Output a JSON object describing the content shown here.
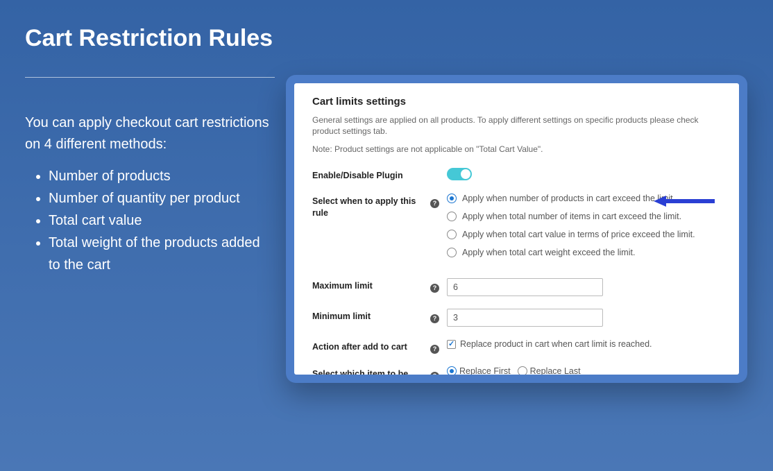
{
  "left": {
    "title": "Cart Restriction Rules",
    "intro": "You can apply checkout cart restrictions on 4 different methods:",
    "bullets": [
      "Number of products",
      "Number of quantity per product",
      "Total cart value",
      "Total weight of the products added to the cart"
    ]
  },
  "panel": {
    "title": "Cart limits settings",
    "sub1": "General settings are applied on all products. To apply different settings on specific products please check product settings tab.",
    "sub2": "Note: Product settings are not applicable on \"Total Cart Value\".",
    "enable_label": "Enable/Disable Plugin",
    "rule_label": "Select when to apply this rule",
    "rule_options": [
      "Apply when number of products in cart exceed the limit.",
      "Apply when total number of items in cart exceed the limit.",
      "Apply when total cart value in terms of price exceed the limit.",
      "Apply when total cart weight exceed the limit."
    ],
    "max_label": "Maximum limit",
    "max_value": "6",
    "min_label": "Minimum limit",
    "min_value": "3",
    "action_label": "Action after add to cart",
    "action_text": "Replace product in cart when cart limit is reached.",
    "replace_label": "Select which item to be",
    "replace_first": "Replace First",
    "replace_last": "Replace Last",
    "help_glyph": "?"
  }
}
